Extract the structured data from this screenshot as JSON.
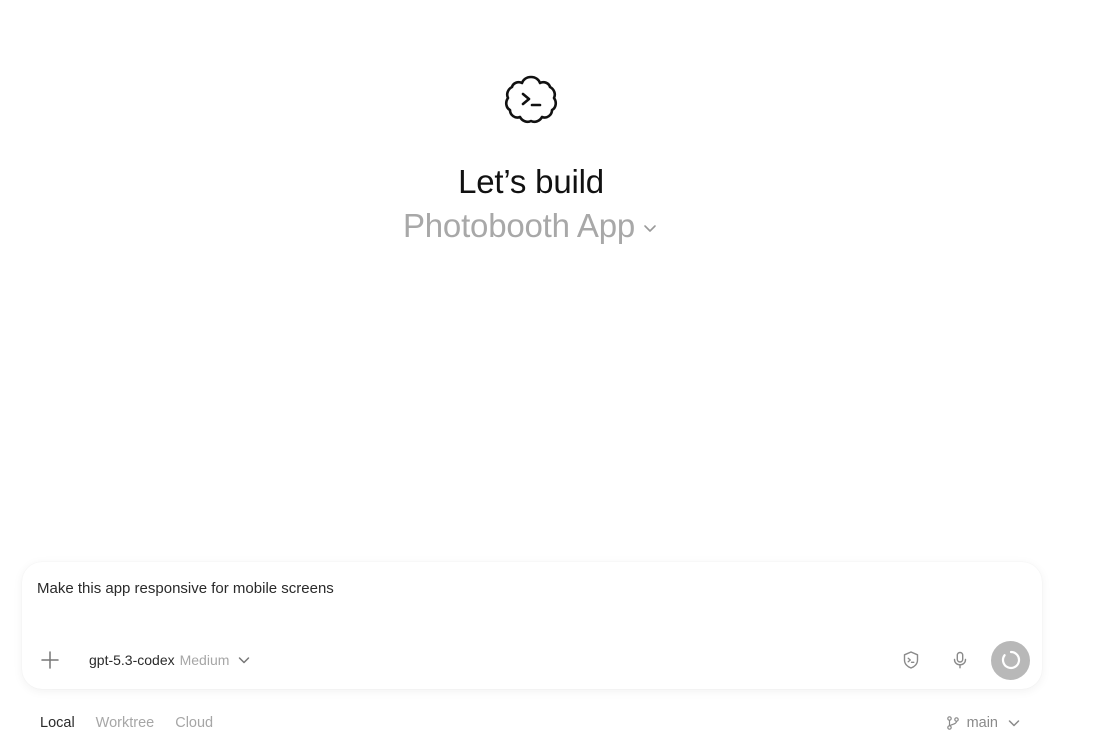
{
  "hero": {
    "title": "Let’s build",
    "project_name": "Photobooth App"
  },
  "composer": {
    "prompt_text": "Make this app responsive for mobile screens",
    "model_name": "gpt-5.3-codex",
    "reasoning_effort": "Medium"
  },
  "footer": {
    "modes": [
      "Local",
      "Worktree",
      "Cloud"
    ],
    "active_mode": "Local",
    "branch": "main"
  },
  "icons": {
    "logo": "codex-cloud-terminal-icon",
    "project_dropdown": "chevron-down-icon",
    "add": "plus-icon",
    "model_dropdown": "chevron-down-icon",
    "terminal": "terminal-shield-icon",
    "microphone": "microphone-icon",
    "send": "loading-spinner-icon",
    "branch": "git-branch-icon",
    "branch_dropdown": "chevron-down-icon"
  },
  "colors": {
    "text_primary": "#111111",
    "text_muted": "#a6a6a6",
    "send_button": "#b8b8b8",
    "background": "#ffffff"
  }
}
